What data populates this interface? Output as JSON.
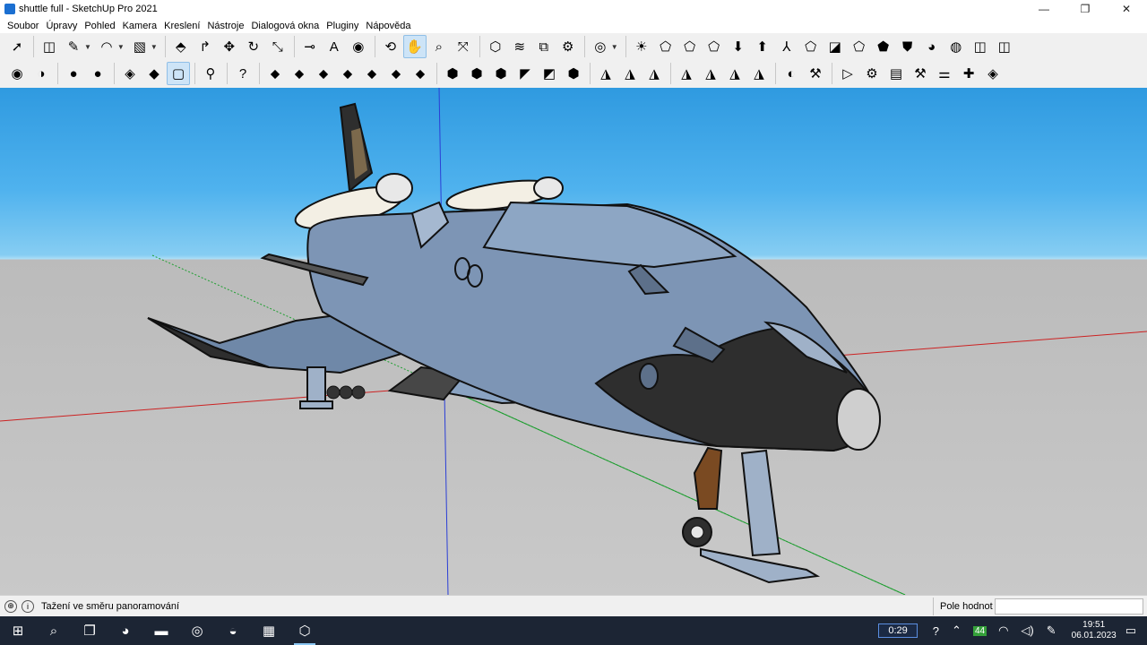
{
  "window": {
    "title": "shuttle full - SketchUp Pro 2021"
  },
  "menu": [
    "Soubor",
    "Úpravy",
    "Pohled",
    "Kamera",
    "Kreslení",
    "Nástroje",
    "Dialogová okna",
    "Pluginy",
    "Nápověda"
  ],
  "toolbar1": [
    {
      "name": "select-tool-icon",
      "glyph": "➚"
    },
    {
      "name": "eraser-tool-icon",
      "glyph": "◫"
    },
    {
      "name": "pencil-tool-icon",
      "glyph": "✎",
      "dropdown": true
    },
    {
      "name": "arc-tool-icon",
      "glyph": "◠",
      "dropdown": true
    },
    {
      "name": "rectangle-tool-icon",
      "glyph": "▧",
      "dropdown": true
    },
    {
      "name": "push-pull-tool-icon",
      "glyph": "⬘"
    },
    {
      "name": "follow-me-tool-icon",
      "glyph": "↱"
    },
    {
      "name": "move-tool-icon",
      "glyph": "✥"
    },
    {
      "name": "rotate-tool-icon",
      "glyph": "↻"
    },
    {
      "name": "scale-tool-icon",
      "glyph": "⤡"
    },
    {
      "name": "tape-measure-icon",
      "glyph": "⊸"
    },
    {
      "name": "text-tool-icon",
      "glyph": "A"
    },
    {
      "name": "paint-bucket-icon",
      "glyph": "◉"
    },
    {
      "name": "orbit-tool-icon",
      "glyph": "⟲"
    },
    {
      "name": "pan-tool-icon",
      "glyph": "✋",
      "active": true
    },
    {
      "name": "zoom-tool-icon",
      "glyph": "⌕"
    },
    {
      "name": "zoom-extents-icon",
      "glyph": "⤧"
    },
    {
      "name": "warehouse-icon",
      "glyph": "⬡"
    },
    {
      "name": "extension-warehouse-icon",
      "glyph": "≋"
    },
    {
      "name": "layout-send-icon",
      "glyph": "⧉"
    },
    {
      "name": "extension-manager-icon",
      "glyph": "⚙"
    },
    {
      "name": "account-icon",
      "glyph": "◎",
      "dropdown": true
    },
    {
      "name": "sun-shadow-icon",
      "glyph": "☀"
    },
    {
      "name": "solid-tools-union-icon",
      "glyph": "⬠"
    },
    {
      "name": "solid-tools-subtract-icon",
      "glyph": "⬠"
    },
    {
      "name": "solid-tools-intersect-icon",
      "glyph": "⬠"
    },
    {
      "name": "arrow-down-icon",
      "glyph": "⬇"
    },
    {
      "name": "arrow-up-icon",
      "glyph": "⬆"
    },
    {
      "name": "axes-tool-icon",
      "glyph": "⅄"
    },
    {
      "name": "solid-outer-shell-icon",
      "glyph": "⬠"
    },
    {
      "name": "section-plane-icon",
      "glyph": "◪"
    },
    {
      "name": "solid-split-icon",
      "glyph": "⬠"
    },
    {
      "name": "solid-trim-icon",
      "glyph": "⬟"
    },
    {
      "name": "shield-icon",
      "glyph": "⛊"
    },
    {
      "name": "style-paint-icon",
      "glyph": "◕"
    },
    {
      "name": "globe-style-icon",
      "glyph": "◍"
    },
    {
      "name": "eraser-soft-icon",
      "glyph": "◫"
    },
    {
      "name": "eraser-smooth-icon",
      "glyph": "◫"
    }
  ],
  "toolbar2": [
    {
      "name": "camera-position-icon",
      "glyph": "◉"
    },
    {
      "name": "look-around-icon",
      "glyph": "◑"
    },
    {
      "name": "component-icon",
      "glyph": "●"
    },
    {
      "name": "group-icon",
      "glyph": "●"
    },
    {
      "name": "hide-geometry-icon",
      "glyph": "◈"
    },
    {
      "name": "section-fill-icon",
      "glyph": "◆"
    },
    {
      "name": "xray-icon",
      "glyph": "▢",
      "active": true
    },
    {
      "name": "walk-tool-icon",
      "glyph": "⚲"
    },
    {
      "name": "help-icon",
      "glyph": "?"
    },
    {
      "name": "sandbox-from-contours-icon",
      "glyph": "⬥"
    },
    {
      "name": "sandbox-from-scratch-icon",
      "glyph": "⬥"
    },
    {
      "name": "sandbox-smoove-icon",
      "glyph": "⬥"
    },
    {
      "name": "sandbox-stamp-icon",
      "glyph": "⬥"
    },
    {
      "name": "sandbox-drape-icon",
      "glyph": "⬥"
    },
    {
      "name": "sandbox-add-detail-icon",
      "glyph": "⬥"
    },
    {
      "name": "sandbox-flip-edge-icon",
      "glyph": "⬥"
    },
    {
      "name": "view-iso-icon",
      "glyph": "⬢"
    },
    {
      "name": "view-top-icon",
      "glyph": "⬢"
    },
    {
      "name": "view-front-icon",
      "glyph": "⬢"
    },
    {
      "name": "view-right-icon",
      "glyph": "◤"
    },
    {
      "name": "view-back-icon",
      "glyph": "◩"
    },
    {
      "name": "view-left-icon",
      "glyph": "⬢"
    },
    {
      "name": "style-xray-icon",
      "glyph": "◮"
    },
    {
      "name": "style-back-edges-icon",
      "glyph": "◮"
    },
    {
      "name": "style-wireframe-icon",
      "glyph": "◮"
    },
    {
      "name": "style-hidden-line-icon",
      "glyph": "◮"
    },
    {
      "name": "style-shaded-icon",
      "glyph": "◮"
    },
    {
      "name": "style-textured-icon",
      "glyph": "◮"
    },
    {
      "name": "style-monochrome-icon",
      "glyph": "◮"
    },
    {
      "name": "plugin-sun-icon",
      "glyph": "◐"
    },
    {
      "name": "plugin-tools-icon",
      "glyph": "⚒"
    },
    {
      "name": "play-icon",
      "glyph": "▷"
    },
    {
      "name": "settings-icon",
      "glyph": "⚙"
    },
    {
      "name": "document-icon",
      "glyph": "▤"
    },
    {
      "name": "wrench-icon",
      "glyph": "⚒"
    },
    {
      "name": "sliders-icon",
      "glyph": "⚌"
    },
    {
      "name": "plus-icon",
      "glyph": "✚"
    },
    {
      "name": "tag-icon",
      "glyph": "◈"
    }
  ],
  "status": {
    "text": "Tažení ve směru panoramování",
    "measure_label": "Pole hodnot",
    "measure_value": ""
  },
  "taskbar": {
    "apps": [
      {
        "name": "start-icon",
        "glyph": "⊞"
      },
      {
        "name": "search-icon",
        "glyph": "⌕"
      },
      {
        "name": "task-view-icon",
        "glyph": "❐"
      },
      {
        "name": "edge-browser-icon",
        "glyph": "◕"
      },
      {
        "name": "file-explorer-icon",
        "glyph": "▬"
      },
      {
        "name": "chrome-browser-icon",
        "glyph": "◎"
      },
      {
        "name": "firefox-browser-icon",
        "glyph": "◒"
      },
      {
        "name": "app-icon",
        "glyph": "▦"
      },
      {
        "name": "sketchup-app-icon",
        "glyph": "⬡",
        "active": true
      }
    ],
    "timer": "0:29",
    "badge": "44",
    "time": "19:51",
    "date": "06.01.2023"
  },
  "colors": {
    "sky_top": "#2f9ae0",
    "ground": "#c4c4c4",
    "hull": "#7d95b5",
    "nose": "#2e2e2e",
    "axis_red": "#cc2222",
    "axis_green": "#1e9e30",
    "axis_blue": "#2a3ed6"
  }
}
